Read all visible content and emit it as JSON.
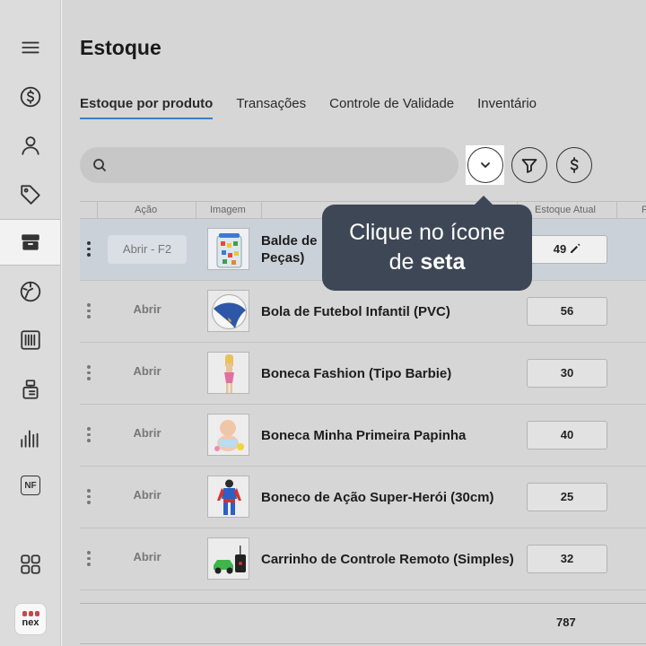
{
  "page": {
    "title": "Estoque"
  },
  "tabs": [
    {
      "label": "Estoque por produto",
      "active": true
    },
    {
      "label": "Transações",
      "active": false
    },
    {
      "label": "Controle de Validade",
      "active": false
    },
    {
      "label": "Inventário",
      "active": false
    }
  ],
  "sidebar": {
    "items": [
      {
        "icon": "menu-icon"
      },
      {
        "icon": "dollar-circle-icon"
      },
      {
        "icon": "user-icon"
      },
      {
        "icon": "tag-icon"
      },
      {
        "icon": "box-icon",
        "active": true
      },
      {
        "icon": "gauge-icon"
      },
      {
        "icon": "barcode-icon"
      },
      {
        "icon": "register-icon"
      },
      {
        "icon": "bar-chart-icon"
      },
      {
        "icon": "invoice-icon",
        "label": "NF"
      },
      {
        "icon": "apps-grid-icon"
      }
    ],
    "logo_text": "nex"
  },
  "search": {
    "placeholder": ""
  },
  "toolbar": {
    "dropdown_icon": "chevron-down-icon",
    "filter_icon": "filter-icon",
    "price_icon": "dollar-icon"
  },
  "table": {
    "headers": {
      "action": "Ação",
      "image": "Imagem",
      "stock": "Estoque Atual",
      "next": "P"
    },
    "rows": [
      {
        "action": "Abrir - F2",
        "name_line1": "Balde de",
        "name_line2": "Peças)",
        "stock": "49",
        "highlight": true
      },
      {
        "action": "Abrir",
        "name": "Bola de Futebol Infantil (PVC)",
        "stock": "56"
      },
      {
        "action": "Abrir",
        "name": "Boneca Fashion (Tipo Barbie)",
        "stock": "30"
      },
      {
        "action": "Abrir",
        "name": "Boneca Minha Primeira Papinha",
        "stock": "40"
      },
      {
        "action": "Abrir",
        "name": "Boneco de Ação Super-Herói (30cm)",
        "stock": "25"
      },
      {
        "action": "Abrir",
        "name": "Carrinho de Controle Remoto (Simples)",
        "stock": "32"
      }
    ],
    "total": "787"
  },
  "tooltip": {
    "line1": "Clique no ícone",
    "line2_prefix": "de ",
    "line2_bold": "seta"
  },
  "colors": {
    "accent": "#3a7fc0",
    "tooltip_bg": "#3e4756",
    "logo_red": "#c64848"
  }
}
